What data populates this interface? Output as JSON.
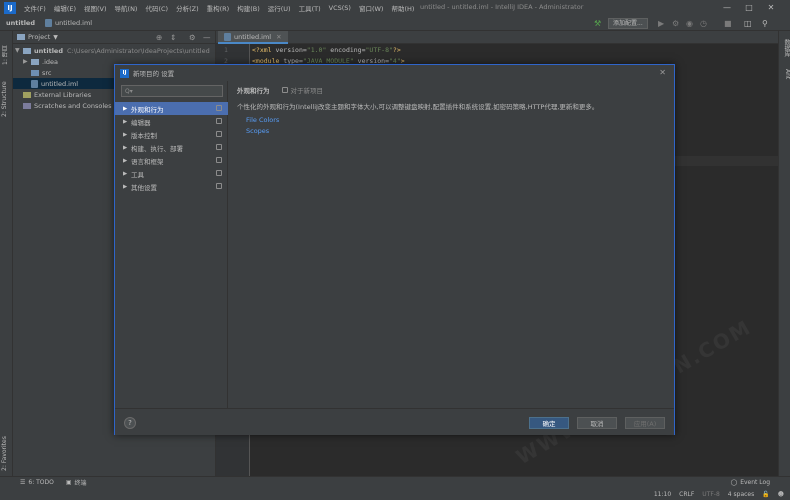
{
  "titlebar": {
    "menus": [
      "文件(F)",
      "编辑(E)",
      "视图(V)",
      "导航(N)",
      "代码(C)",
      "分析(Z)",
      "重构(R)",
      "构建(B)",
      "运行(U)",
      "工具(T)",
      "VCS(S)",
      "窗口(W)",
      "帮助(H)"
    ],
    "window_title": "untitled - untitled.iml - IntelliJ IDEA - Administrator",
    "logo": "IJ"
  },
  "navbar": {
    "project": "untitled",
    "file": "untitled.iml",
    "add_config": "添加配置..."
  },
  "left_strip": {
    "tab1": "1: 项目",
    "tab2": "2: Structure",
    "tab3": "2: Favorites"
  },
  "right_strip": {
    "tab1": "数据库",
    "tab2": "Ant"
  },
  "project_panel": {
    "title": "Project",
    "root": "untitled",
    "root_path": "C:\\Users\\Administrator\\IdeaProjects\\untitled",
    "items": [
      ".idea",
      "src",
      "untitled.iml"
    ],
    "external": "External Libraries",
    "scratches": "Scratches and Consoles"
  },
  "editor": {
    "tab": "untitled.iml",
    "lines": [
      "1",
      "2"
    ],
    "line1": {
      "tag": "<?xml ",
      "a1": "version=",
      "v1": "\"1.0\"",
      "a2": " encoding=",
      "v2": "\"UTF-8\"",
      "end": "?>"
    },
    "line2": {
      "tag": "<module ",
      "a1": "type=",
      "v1": "\"JAVA_MODULE\"",
      "a2": " version=",
      "v2": "\"4\"",
      "end": ">"
    }
  },
  "dialog": {
    "title": "新项目的 设置",
    "logo": "IJ",
    "search_placeholder": "Q▾",
    "items": [
      {
        "label": "外观和行为",
        "selected": true
      },
      {
        "label": "编辑器"
      },
      {
        "label": "版本控制"
      },
      {
        "label": "构建、执行、部署"
      },
      {
        "label": "语言和框架"
      },
      {
        "label": "工具"
      },
      {
        "label": "其他设置"
      }
    ],
    "section_title": "外观和行为",
    "for_new_project": "对于新项目",
    "description": "个性化的外观和行为(IntelliJ改变主题和字体大小,可以调整键盘映射,配置插件和系统设置,如密码策略,HTTP代理,更新和更多。",
    "links": [
      "File Colors",
      "Scopes"
    ],
    "ok": "确定",
    "cancel": "取消",
    "apply": "应用(A)",
    "help": "?"
  },
  "bottom": {
    "todo": "6: TODO",
    "terminal": "终端",
    "event_log": "Event Log"
  },
  "status": {
    "position": "11:10",
    "line_sep": "CRLF",
    "encoding": "UTF-8",
    "indent": "4 spaces"
  },
  "watermark": "WWW.WEDOWN.COM"
}
